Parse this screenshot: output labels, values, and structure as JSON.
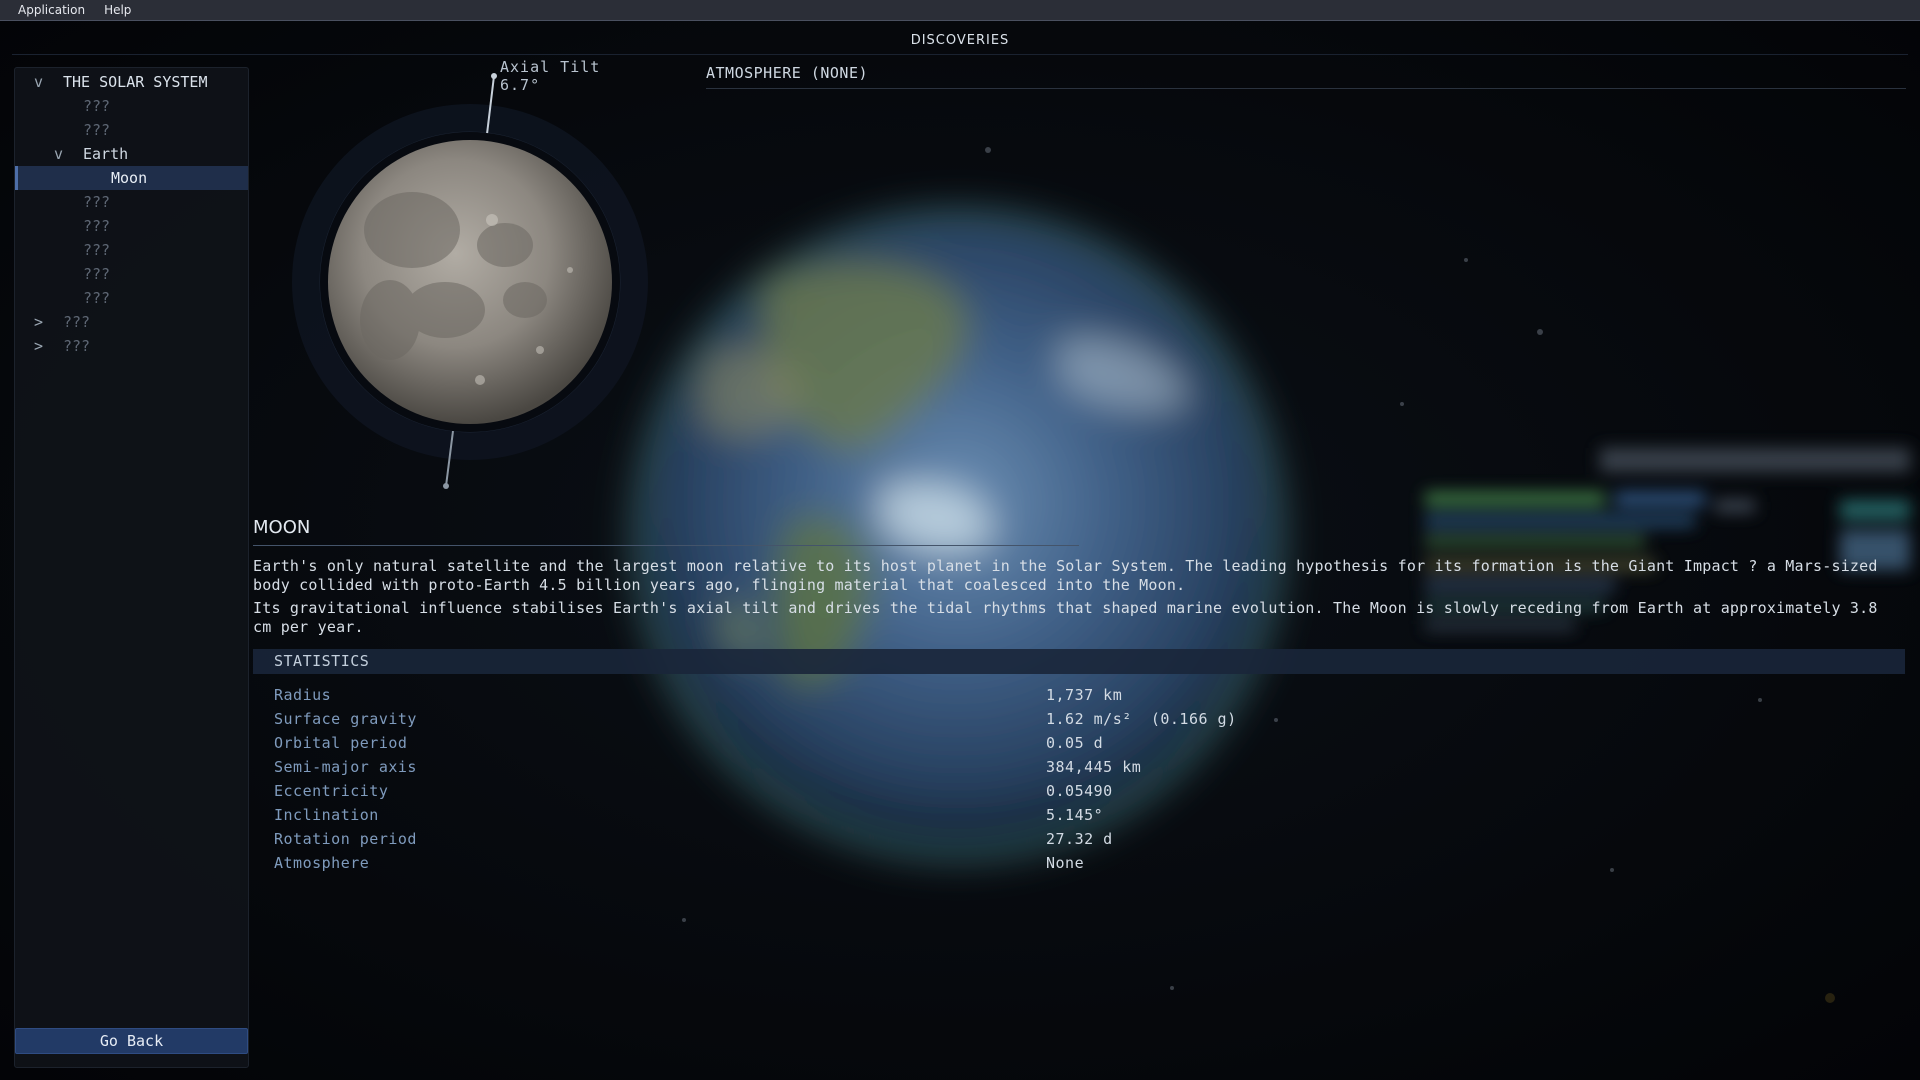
{
  "menu": {
    "items": [
      "Application",
      "Help"
    ]
  },
  "page_title": "DISCOVERIES",
  "tree": {
    "root": {
      "expander": "v",
      "label": "THE SOLAR SYSTEM"
    },
    "items": [
      {
        "label": "???",
        "level": 2,
        "state": "unknown"
      },
      {
        "label": "???",
        "level": 2,
        "state": "unknown"
      },
      {
        "label": "Earth",
        "level": 1,
        "expander": "v",
        "state": "known"
      },
      {
        "label": "Moon",
        "level": 3,
        "state": "selected"
      },
      {
        "label": "???",
        "level": 2,
        "state": "unknown"
      },
      {
        "label": "???",
        "level": 2,
        "state": "unknown"
      },
      {
        "label": "???",
        "level": 2,
        "state": "unknown"
      },
      {
        "label": "???",
        "level": 2,
        "state": "unknown"
      },
      {
        "label": "???",
        "level": 2,
        "state": "unknown"
      },
      {
        "label": "???",
        "level": 0,
        "expander": ">",
        "state": "unknown"
      },
      {
        "label": "???",
        "level": 0,
        "expander": ">",
        "state": "unknown"
      }
    ]
  },
  "go_back_label": "Go Back",
  "axial_tilt": {
    "label": "Axial Tilt",
    "value": "6.7°"
  },
  "atmosphere_header": "ATMOSPHERE (NONE)",
  "body": {
    "name": "MOON",
    "description": [
      "Earth's only natural satellite and the largest moon relative to its host planet in the Solar System. The leading hypothesis for its formation is the Giant Impact ? a Mars-sized body collided with proto-Earth 4.5 billion years ago, flinging material that coalesced into the Moon.",
      "Its gravitational influence stabilises Earth's axial tilt and drives the tidal rhythms that shaped marine evolution. The Moon is slowly receding from Earth at approximately 3.8 cm per year."
    ]
  },
  "statistics": {
    "header": "STATISTICS",
    "rows": [
      {
        "label": "Radius",
        "value": "1,737 km"
      },
      {
        "label": "Surface gravity",
        "value": "1.62 m/s²  (0.166 g)"
      },
      {
        "label": "Orbital period",
        "value": "0.05 d"
      },
      {
        "label": "Semi-major axis",
        "value": "384,445 km"
      },
      {
        "label": "Eccentricity",
        "value": "0.05490"
      },
      {
        "label": "Inclination",
        "value": "5.145°"
      },
      {
        "label": "Rotation period",
        "value": "27.32 d"
      },
      {
        "label": "Atmosphere",
        "value": "None"
      }
    ]
  },
  "colors": {
    "accent": "#223a66",
    "selection": "#1f2e4a",
    "stat_label": "#7f9bbd",
    "menubar": "#2b2e37"
  }
}
